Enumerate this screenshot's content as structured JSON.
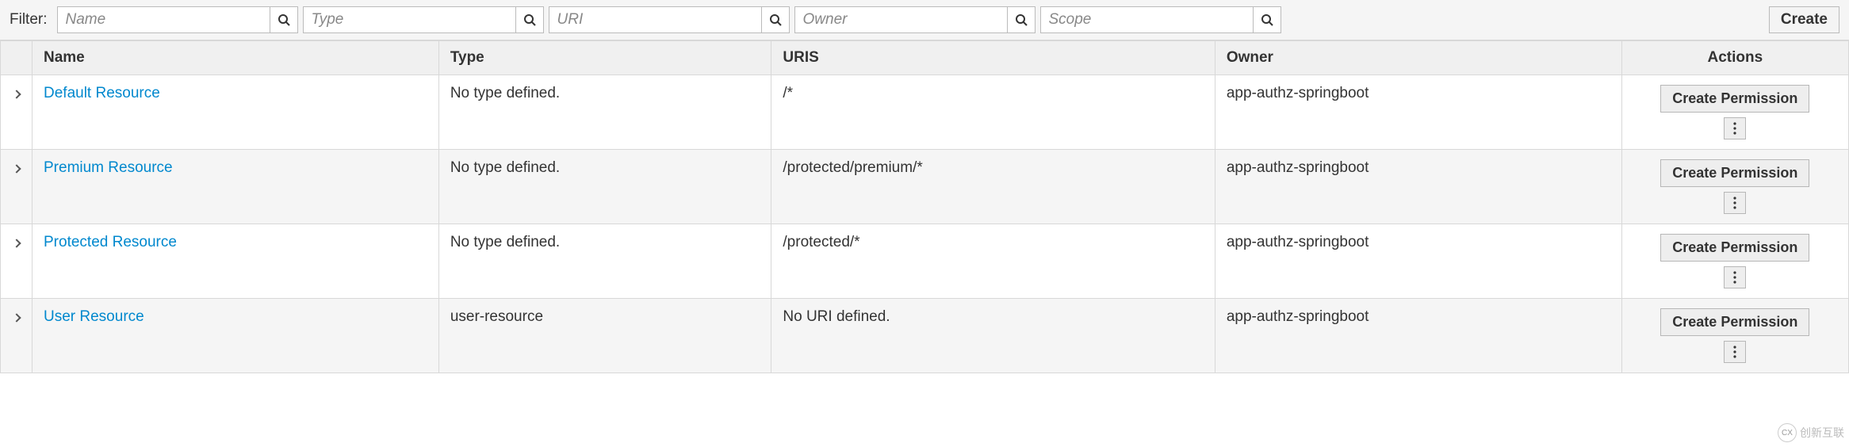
{
  "filter": {
    "label": "Filter:",
    "inputs": [
      {
        "placeholder": "Name"
      },
      {
        "placeholder": "Type"
      },
      {
        "placeholder": "URI"
      },
      {
        "placeholder": "Owner"
      },
      {
        "placeholder": "Scope"
      }
    ],
    "create_label": "Create"
  },
  "table": {
    "headers": {
      "name": "Name",
      "type": "Type",
      "uris": "URIS",
      "owner": "Owner",
      "actions": "Actions"
    },
    "rows": [
      {
        "name": "Default Resource",
        "type": "No type defined.",
        "uris": "/*",
        "owner": "app-authz-springboot",
        "action_label": "Create Permission"
      },
      {
        "name": "Premium Resource",
        "type": "No type defined.",
        "uris": "/protected/premium/*",
        "owner": "app-authz-springboot",
        "action_label": "Create Permission"
      },
      {
        "name": "Protected Resource",
        "type": "No type defined.",
        "uris": "/protected/*",
        "owner": "app-authz-springboot",
        "action_label": "Create Permission"
      },
      {
        "name": "User Resource",
        "type": "user-resource",
        "uris": "No URI defined.",
        "owner": "app-authz-springboot",
        "action_label": "Create Permission"
      }
    ]
  },
  "watermark": {
    "text": "创新互联"
  }
}
